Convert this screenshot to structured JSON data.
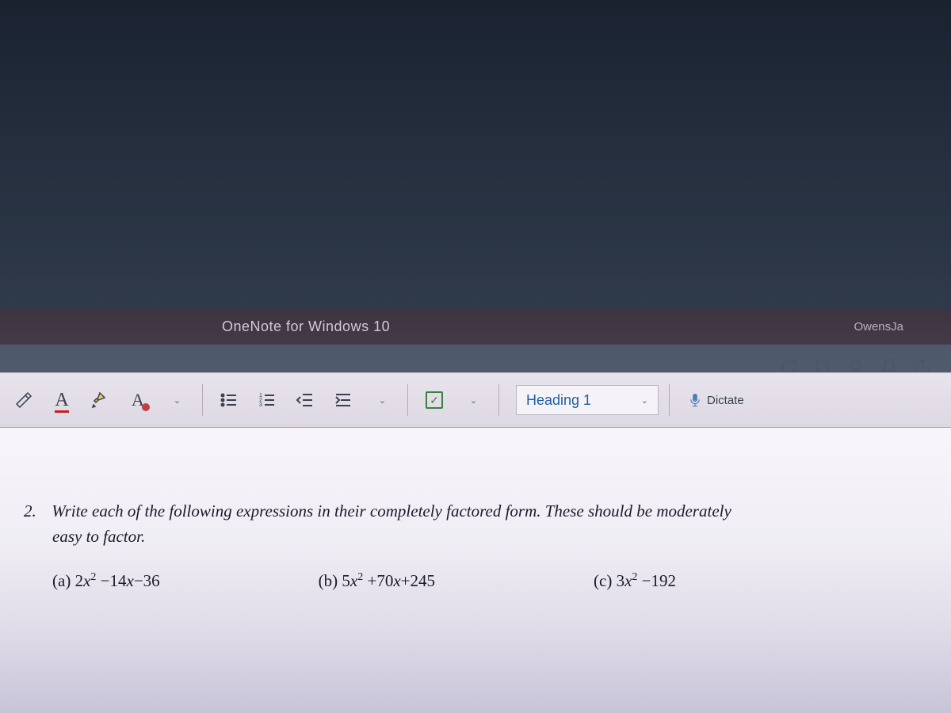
{
  "titlebar": {
    "app_name": "OneNote for Windows 10",
    "user_name": "OwensJa"
  },
  "ribbon": {
    "heading_style": "Heading 1",
    "dictate_label": "Dictate"
  },
  "content": {
    "problem_number": "2.",
    "problem_text_line1": "Write each of the following expressions in their completely factored form.  These should be moderately",
    "problem_text_line2": "easy to factor.",
    "expr_a_label": "(a)",
    "expr_a": "2x² −14x−36",
    "expr_b_label": "(b)",
    "expr_b": "5x² +70x+245",
    "expr_c_label": "(c)",
    "expr_c": "3x² −192"
  }
}
